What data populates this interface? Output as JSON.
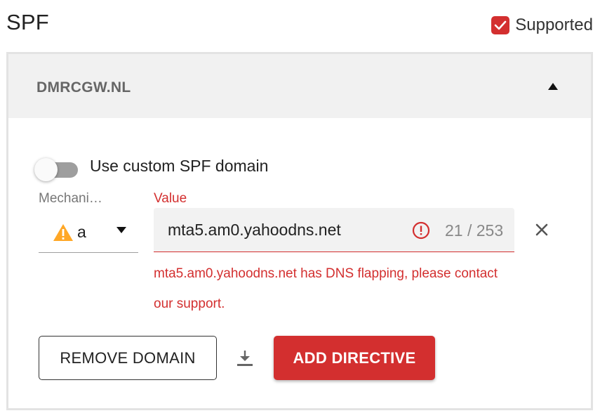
{
  "header": {
    "title": "SPF",
    "supported": {
      "label": "Supported",
      "checked": true
    }
  },
  "colors": {
    "accent": "#d32f2f",
    "warning": "#ffa726",
    "header_bg": "#f1f1f1",
    "toggle_off": "#9e9e9e"
  },
  "domain_panel": {
    "name": "DMRCGW.NL",
    "expanded": true,
    "icons": {
      "collapse": "triangle-up-icon"
    },
    "custom_spf": {
      "label": "Use custom SPF domain",
      "enabled": false
    },
    "directive": {
      "mechanism_label": "Mechani…",
      "mechanism_value": "a",
      "mechanism_icon": "warning-icon",
      "value_label": "Value",
      "value": "mta5.am0.yahoodns.net",
      "char_count": "21 / 253",
      "error_icon": "error-icon",
      "remove_icon": "close-icon",
      "error_message": "mta5.am0.yahoodns.net has DNS flapping, please contact our support."
    },
    "actions": {
      "remove_domain": "REMOVE DOMAIN",
      "download_icon": "download-icon",
      "add_directive": "ADD DIRECTIVE"
    }
  }
}
